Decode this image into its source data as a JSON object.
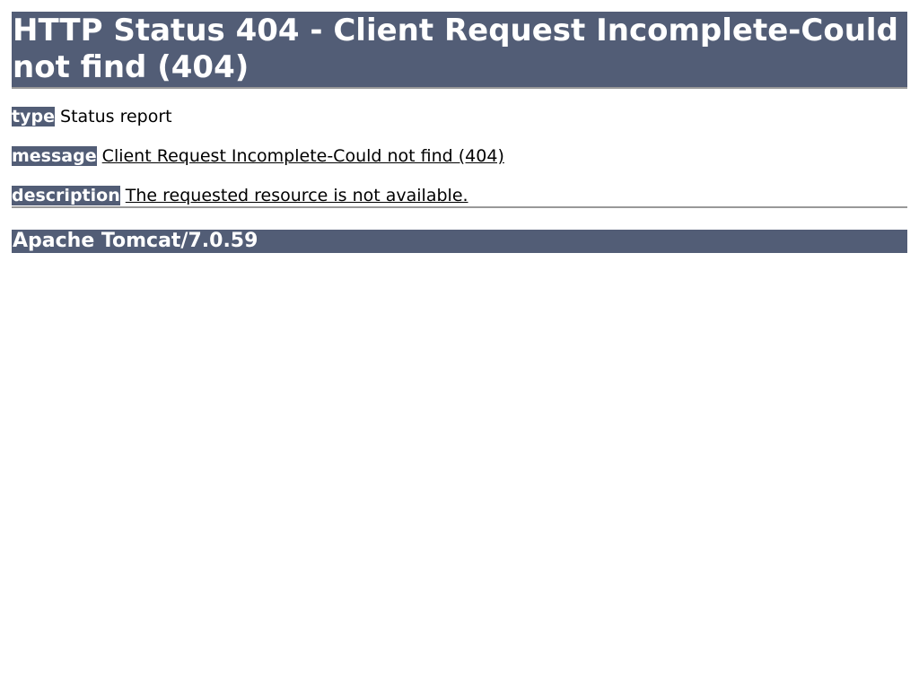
{
  "heading": {
    "title": "HTTP Status 404 - Client Request Incomplete-Could not find (404)"
  },
  "report": {
    "type_label": "type",
    "type_value": "Status report",
    "message_label": "message",
    "message_value": "Client Request Incomplete-Could not find (404)",
    "description_label": "description",
    "description_value": "The requested resource is not available."
  },
  "footer": {
    "server": "Apache Tomcat/7.0.59"
  },
  "colors": {
    "header_bg": "#525d76",
    "header_text": "#ffffff",
    "rule": "#999999"
  }
}
